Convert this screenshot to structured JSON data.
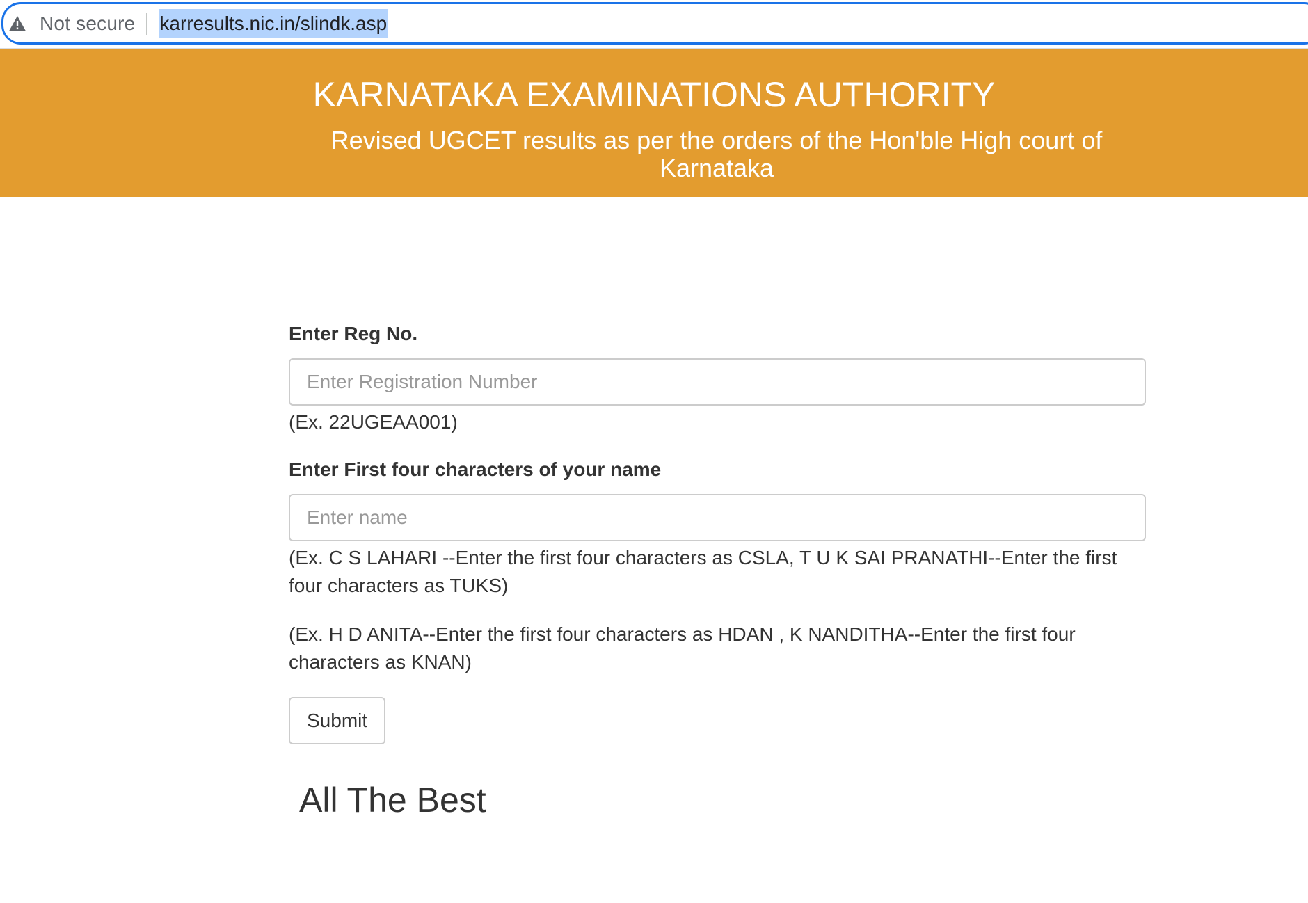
{
  "browser": {
    "security_text": "Not secure",
    "url": "karresults.nic.in/slindk.asp",
    "icons": {
      "security": "warning-triangle-icon"
    }
  },
  "banner": {
    "title": "KARNATAKA EXAMINATIONS AUTHORITY",
    "subtitle": "Revised UGCET results as per the orders of the Hon'ble High court of Karnataka",
    "background_color": "#e39c2f"
  },
  "form": {
    "reg_label": "Enter Reg No.",
    "reg_placeholder": "Enter Registration Number",
    "reg_value": "",
    "reg_example": "(Ex. 22UGEAA001)",
    "name_label": "Enter First four characters of your name",
    "name_placeholder": "Enter name",
    "name_value": "",
    "name_example_1": "(Ex. C S LAHARI --Enter the first four characters as CSLA, T U K SAI PRANATHI--Enter the first four characters as TUKS)",
    "name_example_2": "(Ex. H D ANITA--Enter the first four characters as HDAN , K NANDITHA--Enter the first four characters as KNAN)",
    "submit_label": "Submit"
  },
  "footer": {
    "message": "All The Best"
  }
}
